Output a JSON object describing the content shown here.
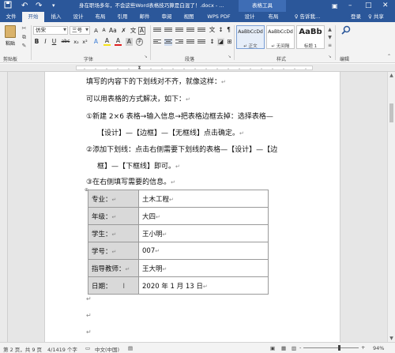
{
  "titlebar": {
    "save_icon": "save-icon",
    "undo_icon": "undo-icon",
    "redo_icon": "redo-icon",
    "customize_icon": "customize-icon",
    "title": "身在职场多年，不会这些Word表格技巧算是白混了！.docx - ...",
    "tool_tab": "表格工具",
    "ribbon_display_icon": "ribbon-display-icon",
    "minimize_icon": "minimize-icon",
    "maximize_icon": "maximize-icon",
    "close_icon": "close-icon"
  },
  "tabs": [
    {
      "label": "文件"
    },
    {
      "label": "开始"
    },
    {
      "label": "插入"
    },
    {
      "label": "设计"
    },
    {
      "label": "布局"
    },
    {
      "label": "引用"
    },
    {
      "label": "邮件"
    },
    {
      "label": "审阅"
    },
    {
      "label": "视图"
    },
    {
      "label": "WPS PDF"
    },
    {
      "label": "设计"
    },
    {
      "label": "布局"
    },
    {
      "label": "♀ 告诉我..."
    }
  ],
  "account": {
    "login": "登录",
    "share": "♀ 共享"
  },
  "ribbon": {
    "paste_label": "粘贴",
    "font_name": "仿宋",
    "font_size": "三号",
    "clipboard_label": "剪贴板",
    "font_label": "字体",
    "paragraph_label": "段落",
    "styles_label": "样式",
    "styles": [
      {
        "sample": "AaBbCcDd",
        "name": "↵ 正文"
      },
      {
        "sample": "AaBbCcDd",
        "name": "↵ 无间隔"
      },
      {
        "sample": "AaBb",
        "name": "标题 1"
      }
    ],
    "editing_label": "编辑",
    "font_buttons": [
      "B",
      "I",
      "U",
      "abc",
      "x₂",
      "x²",
      "A",
      "A",
      "A"
    ]
  },
  "document": {
    "lines": [
      "填写的内容下的下划线对不齐，就像这样：",
      "可以用表格的方式解决，如下：",
      "①新建 2×6 表格→输入信息→把表格边框去掉：选择表格—",
      "【设计】—【边框】—【无框线】点击确定。",
      "②添加下划线：点击右侧需要下划线的表格—【设计】—【边",
      "框】—【下框线】即可。",
      "③在右侧填写需要的信息。"
    ],
    "table": [
      {
        "label": "专业：",
        "value": "土木工程"
      },
      {
        "label": "年级：",
        "value": "大四"
      },
      {
        "label": "学生：",
        "value": "王小明"
      },
      {
        "label": "学号：",
        "value": "007"
      },
      {
        "label": "指导教师：",
        "value": "王大明"
      },
      {
        "label": "日期：",
        "value": "2020 年 1 月 13 日"
      }
    ],
    "paragraph_mark": "↵",
    "end_mark": "↵"
  },
  "status": {
    "page": "第 2 页，共 9 页",
    "words": "4/1419 个字",
    "language": "中文(中国)",
    "zoom": "94%",
    "zoom_minus": "-",
    "zoom_plus": "+"
  }
}
